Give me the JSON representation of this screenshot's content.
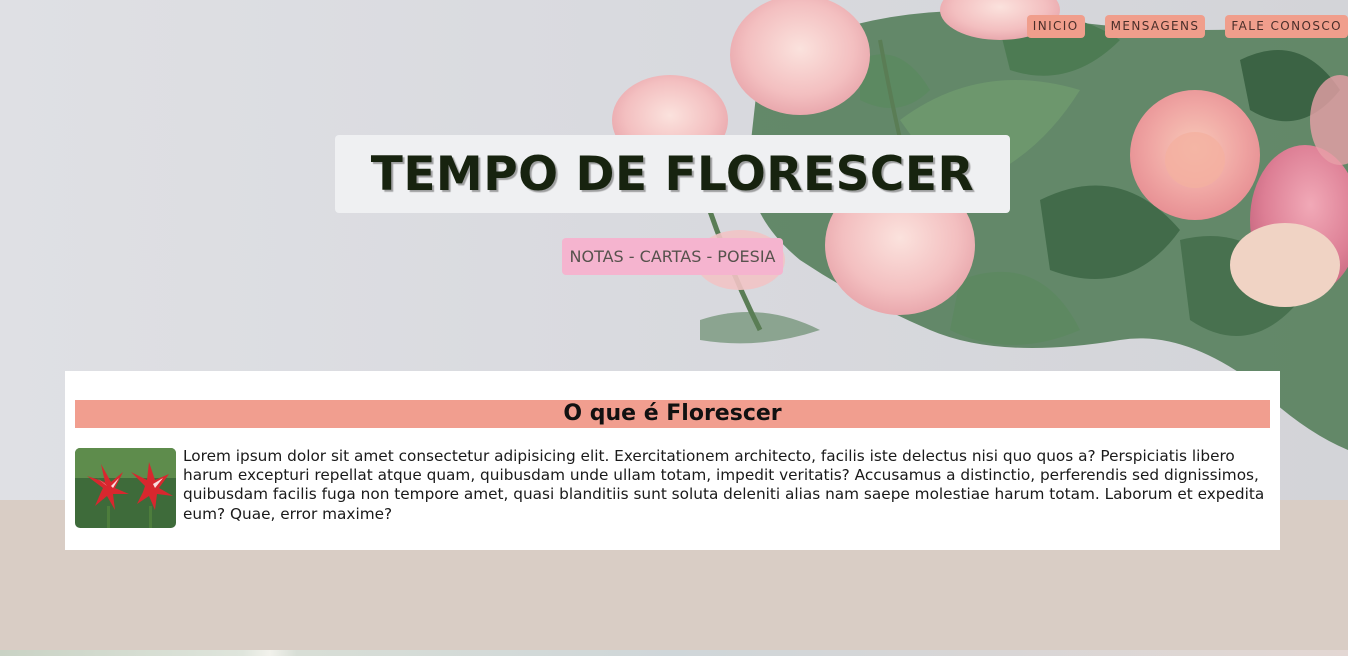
{
  "nav": {
    "items": [
      "INICIO",
      "MENSAGENS",
      "FALE CONOSCO"
    ]
  },
  "hero": {
    "title": "TEMPO DE FLORESCER",
    "subtitle": "NOTAS - CARTAS - POESIA"
  },
  "card": {
    "heading": "O que é Florescer",
    "text": "Lorem ipsum dolor sit amet consectetur adipisicing elit. Exercitationem architecto, facilis iste delectus nisi quo quos a? Perspiciatis libero harum excepturi repellat atque quam, quibusdam unde ullam totam, impedit veritatis? Accusamus a distinctio, perferendis sed dignissimos, quibusdam facilis fuga non tempore amet, quasi blanditiis sunt soluta deleniti alias nam saepe molestiae harum totam. Laborum et expedita eum? Quae, error maxime?"
  },
  "colors": {
    "nav_button": "#f09e8c",
    "subtitle_bg": "#f5b4cf",
    "heading_bar": "#f19e8f",
    "page_bg": "#d9cdc5"
  }
}
